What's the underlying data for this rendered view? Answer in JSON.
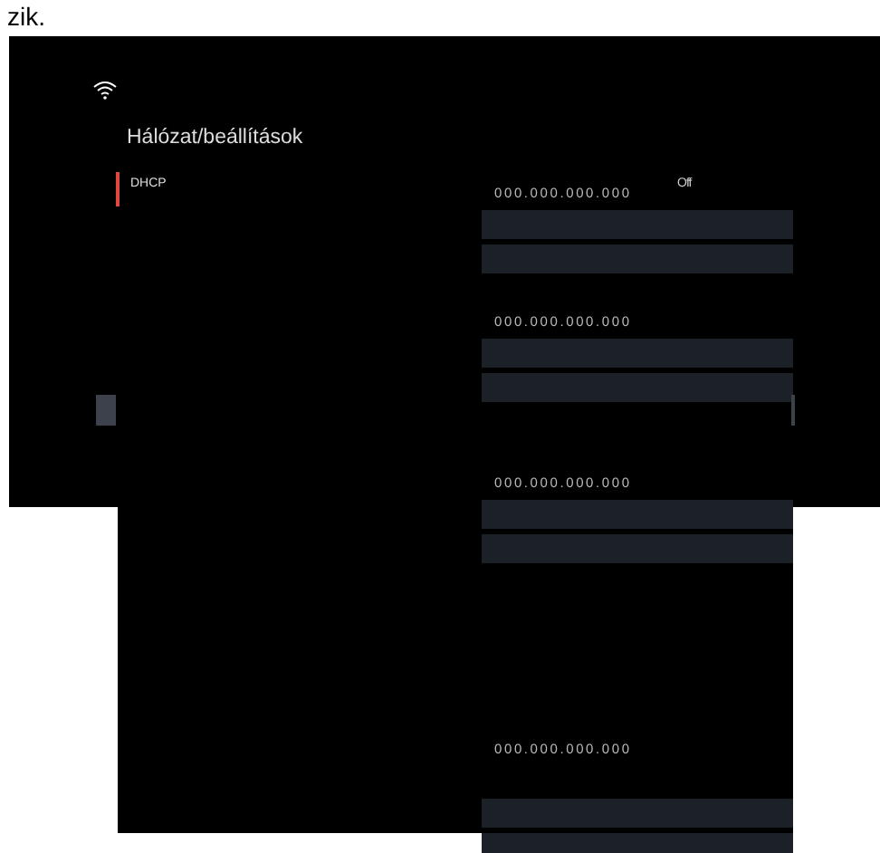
{
  "caption": "zik.",
  "title": "Hálózat/beállítások",
  "menu": [
    {
      "label": "DHCP",
      "selected": true
    }
  ],
  "dhcp_value": "Off",
  "address_groups": [
    {
      "address": "000.000.000.000"
    },
    {
      "address": "000.000.000.000"
    },
    {
      "address": "000.000.000.000"
    },
    {
      "address": "000.000.000.000"
    }
  ]
}
